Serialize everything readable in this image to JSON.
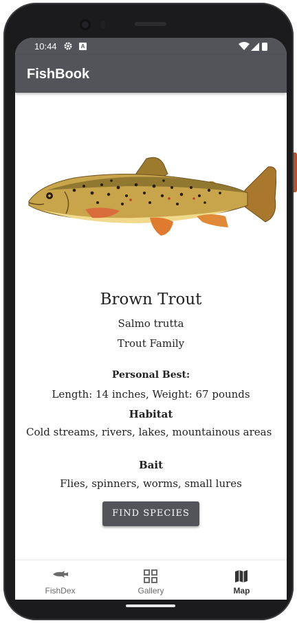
{
  "status_bar": {
    "time": "10:44",
    "icons": [
      "gear-icon",
      "a-badge-icon",
      "wifi-icon",
      "signal-icon",
      "battery-icon"
    ]
  },
  "app_bar": {
    "title": "FishBook"
  },
  "fish": {
    "image_icon": "brown-trout-illustration",
    "name": "Brown Trout",
    "scientific_name": "Salmo trutta",
    "family": "Trout Family",
    "personal_best_title": "Personal Best:",
    "personal_best_value": "Length: 14 inches, Weight: 67 pounds",
    "habitat_title": "Habitat",
    "habitat_value": "Cold streams, rivers, lakes, mountainous areas",
    "bait_title": "Bait",
    "bait_value": "Flies, spinners, worms, small lures"
  },
  "actions": {
    "find_species_label": "FIND SPECIES"
  },
  "bottom_nav": {
    "items": [
      {
        "label": "FishDex",
        "icon": "fish-icon",
        "active": false
      },
      {
        "label": "Gallery",
        "icon": "grid-icon",
        "active": false
      },
      {
        "label": "Map",
        "icon": "map-icon",
        "active": true
      }
    ]
  },
  "colors": {
    "app_bar": "#53545a",
    "button": "#53545a",
    "background": "#ffffff"
  }
}
